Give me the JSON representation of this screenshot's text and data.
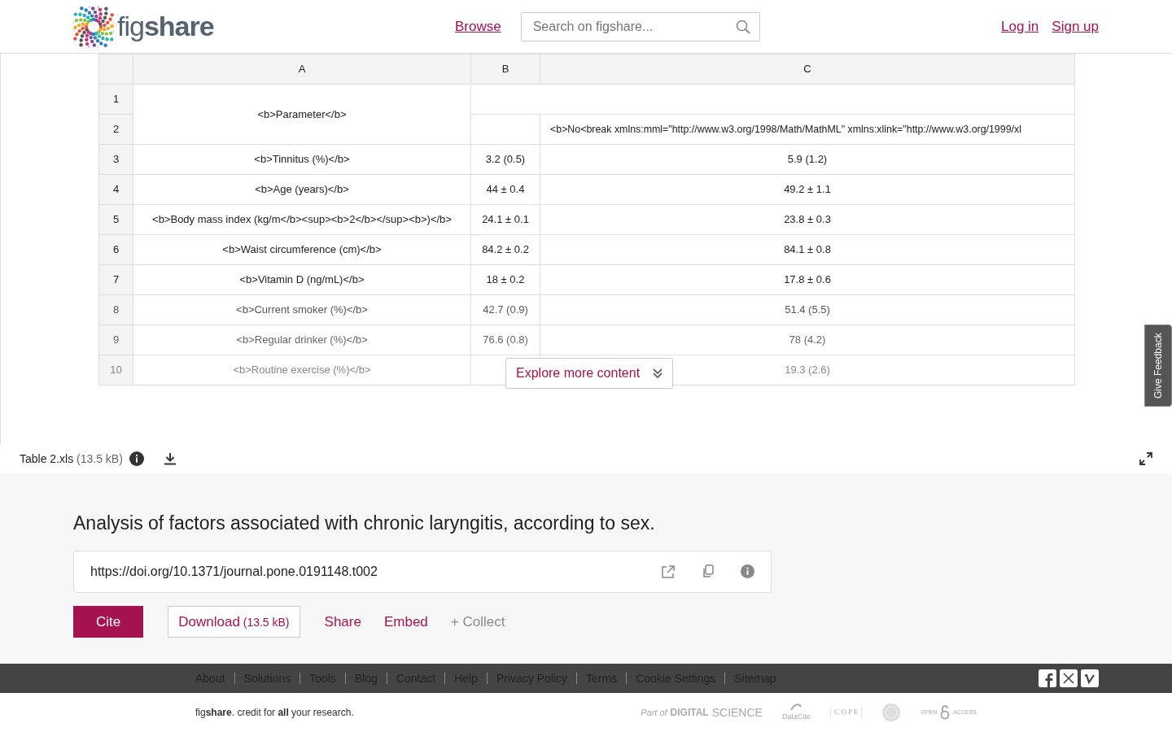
{
  "header": {
    "logo": "fig**share**",
    "browse": "Browse",
    "search": {
      "placeholder": "Search on figshare..."
    },
    "login": "Log in",
    "signup": "Sign up"
  },
  "preview": {
    "columns": [
      "A",
      "B",
      "C"
    ],
    "rows": [
      {
        "num": "1",
        "faded": false,
        "cells": [
          {
            "text": "<b>Parameter</b>",
            "rowspan": 2
          },
          {
            "text": "",
            "colspan": 2
          }
        ]
      },
      {
        "num": "2",
        "faded": false,
        "cells": [
          {
            "text": ""
          },
          {
            "text": "<b>No<break xmlns:mml=\"http://www.w3.org/1998/Math/MathML\" xmlns:xlink=\"http://www.w3.org/1999/xl",
            "kind": "overflow"
          }
        ]
      },
      {
        "num": "3",
        "faded": false,
        "cells": [
          {
            "text": "<b>Tinnitus (%)</b>"
          },
          {
            "text": "3.2 (0.5)"
          },
          {
            "text": "5.9 (1.2)"
          }
        ]
      },
      {
        "num": "4",
        "faded": false,
        "cells": [
          {
            "text": "<b>Age (years)</b>"
          },
          {
            "text": "44 ± 0.4"
          },
          {
            "text": "49.2 ± 1.1"
          }
        ]
      },
      {
        "num": "5",
        "faded": false,
        "cells": [
          {
            "text": "<b>Body mass index (kg/m</b><sup><b>2</b></sup><b>)</b>"
          },
          {
            "text": "24.1 ± 0.1"
          },
          {
            "text": "23.8 ± 0.3"
          }
        ]
      },
      {
        "num": "6",
        "faded": false,
        "cells": [
          {
            "text": "<b>Waist circumference (cm)</b>"
          },
          {
            "text": "84.2 ± 0.2"
          },
          {
            "text": "84.1 ± 0.8"
          }
        ]
      },
      {
        "num": "7",
        "faded": false,
        "cells": [
          {
            "text": "<b>Vitamin D (ng/mL)</b>"
          },
          {
            "text": "18 ± 0.2"
          },
          {
            "text": "17.8 ± 0.6"
          }
        ]
      },
      {
        "num": "8",
        "faded": true,
        "cells": [
          {
            "text": "<b>Current smoker (%)</b>"
          },
          {
            "text": "42.7 (0.9)"
          },
          {
            "text": "51.4 (5.5)"
          }
        ]
      },
      {
        "num": "9",
        "faded": true,
        "cells": [
          {
            "text": "<b>Regular drinker (%)</b>"
          },
          {
            "text": "76.6 (0.8)"
          },
          {
            "text": "78 (4.2)"
          }
        ]
      },
      {
        "num": "10",
        "faded": true,
        "cells": [
          {
            "text": "<b>Routine exercise (%)</b>"
          },
          {
            "text": ""
          },
          {
            "text": "19.3 (2.6)"
          }
        ]
      }
    ],
    "explore": "Explore more content",
    "feedback": "Give Feedback"
  },
  "file": {
    "name": "Table 2.xls",
    "size": "(13.5 kB)"
  },
  "item": {
    "title": "Analysis of factors associated with chronic laryngitis, according to sex.",
    "doi": "https://doi.org/10.1371/journal.pone.0191148.t002",
    "actions": [
      {
        "kind": "primary",
        "label": "Cite"
      },
      {
        "kind": "outline",
        "label": "Download",
        "extra": "(13.5 kB)"
      },
      {
        "kind": "link",
        "label": "Share"
      },
      {
        "kind": "link",
        "label": "Embed"
      },
      {
        "kind": "muted",
        "label": "+ Collect"
      }
    ]
  },
  "footer": {
    "links": [
      "About",
      "Solutions",
      "Tools",
      "Blog",
      "Contact",
      "Help",
      "Privacy Policy",
      "Terms",
      "Cookie Settings",
      "Sitemap"
    ],
    "tagline": "fig**share**. credit for **all** your research.",
    "partners": [
      {
        "kind": "digital",
        "label": "Part of",
        "name": "DIGITAL",
        "name2": "SCIENCE"
      },
      {
        "kind": "datacite",
        "label": "DataCite"
      },
      {
        "kind": "cope",
        "label": "C O P E"
      },
      {
        "kind": "seal"
      },
      {
        "kind": "oa",
        "label": "OPEN",
        "name2": "ACCESS"
      }
    ]
  }
}
